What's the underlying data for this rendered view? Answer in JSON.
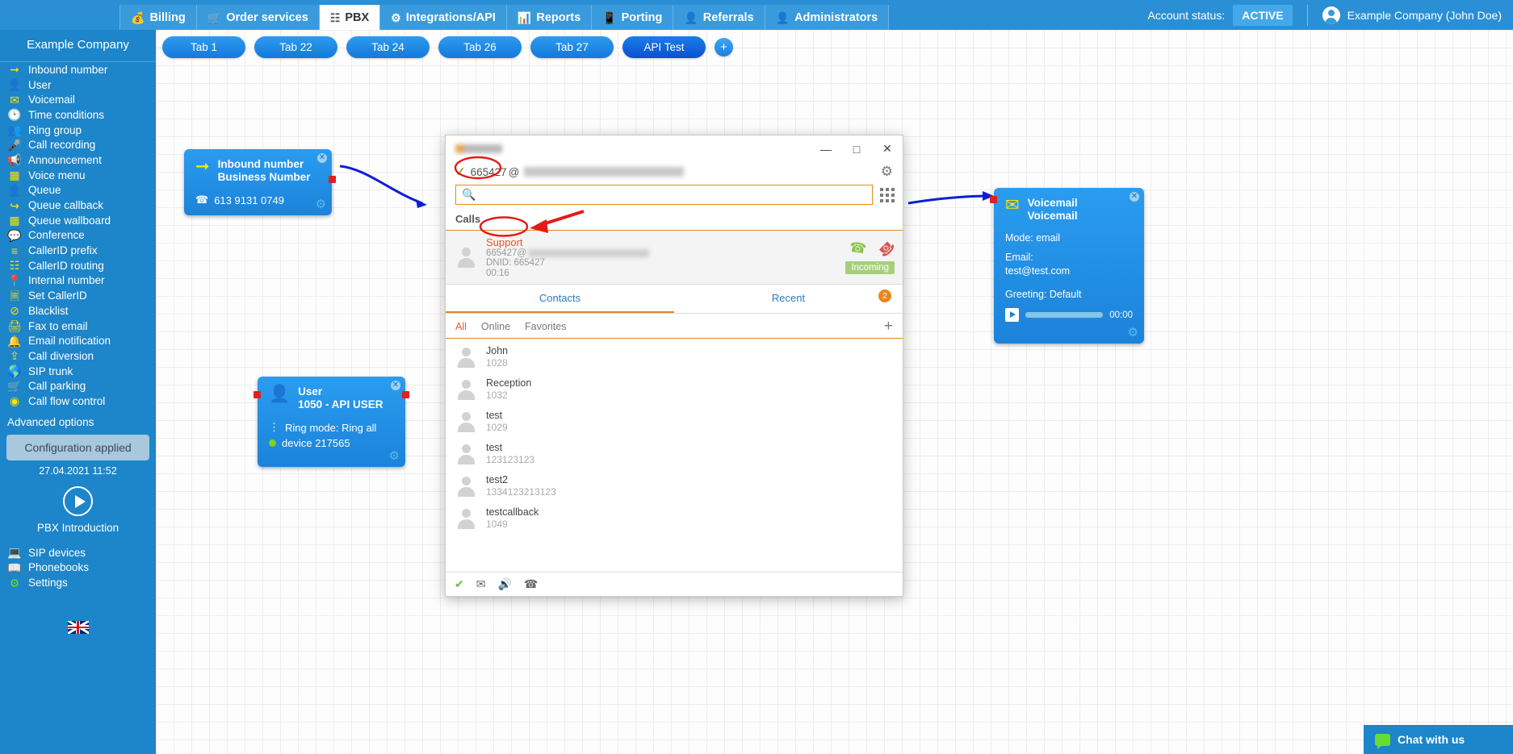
{
  "topnav": {
    "tabs": [
      {
        "label": "Billing",
        "icon": "coin-icon",
        "active": false
      },
      {
        "label": "Order services",
        "icon": "cart-icon",
        "active": false
      },
      {
        "label": "PBX",
        "icon": "pbx-icon",
        "active": true
      },
      {
        "label": "Integrations/API",
        "icon": "gear-icon",
        "active": false
      },
      {
        "label": "Reports",
        "icon": "report-icon",
        "active": false
      },
      {
        "label": "Porting",
        "icon": "phone-icon",
        "active": false
      },
      {
        "label": "Referrals",
        "icon": "person-icon",
        "active": false
      },
      {
        "label": "Administrators",
        "icon": "admin-icon",
        "active": false
      }
    ],
    "account_status_label": "Account status:",
    "account_status_value": "ACTIVE",
    "user_name": "Example Company (John Doe)"
  },
  "sidebar": {
    "title": "Example Company",
    "items": [
      {
        "label": "Inbound number",
        "icon": "arrow-right-icon"
      },
      {
        "label": "User",
        "icon": "user-icon"
      },
      {
        "label": "Voicemail",
        "icon": "envelope-icon"
      },
      {
        "label": "Time conditions",
        "icon": "clock-icon"
      },
      {
        "label": "Ring group",
        "icon": "group-icon"
      },
      {
        "label": "Call recording",
        "icon": "microphone-icon"
      },
      {
        "label": "Announcement",
        "icon": "megaphone-icon"
      },
      {
        "label": "Voice menu",
        "icon": "grid-icon"
      },
      {
        "label": "Queue",
        "icon": "user-plus-icon"
      },
      {
        "label": "Queue callback",
        "icon": "arrow-back-icon"
      },
      {
        "label": "Queue wallboard",
        "icon": "table-icon"
      },
      {
        "label": "Conference",
        "icon": "chat-icon"
      },
      {
        "label": "CallerID prefix",
        "icon": "list-icon"
      },
      {
        "label": "CallerID routing",
        "icon": "sitemap-icon"
      },
      {
        "label": "Internal number",
        "icon": "pin-icon"
      },
      {
        "label": "Set CallerID",
        "icon": "id-card-icon"
      },
      {
        "label": "Blacklist",
        "icon": "ban-icon"
      },
      {
        "label": "Fax to email",
        "icon": "fax-icon"
      },
      {
        "label": "Email notification",
        "icon": "bell-icon"
      },
      {
        "label": "Call diversion",
        "icon": "upload-icon"
      },
      {
        "label": "SIP trunk",
        "icon": "globe-icon"
      },
      {
        "label": "Call parking",
        "icon": "cart-icon"
      },
      {
        "label": "Call flow control",
        "icon": "toggle-icon"
      }
    ],
    "advanced_options": "Advanced options",
    "config_applied": "Configuration applied",
    "config_time": "27.04.2021 11:52",
    "pbx_intro": "PBX Introduction",
    "bottom_items": [
      {
        "label": "SIP devices",
        "icon": "monitor-icon"
      },
      {
        "label": "Phonebooks",
        "icon": "book-icon"
      },
      {
        "label": "Settings",
        "icon": "gear-icon"
      }
    ],
    "language_flag": "uk-flag"
  },
  "flow_tabs": [
    {
      "label": "Tab 1",
      "active": false
    },
    {
      "label": "Tab 22",
      "active": false
    },
    {
      "label": "Tab 24",
      "active": false
    },
    {
      "label": "Tab 26",
      "active": false
    },
    {
      "label": "Tab 27",
      "active": false
    },
    {
      "label": "API Test",
      "active": true
    }
  ],
  "add_tab_label": "+",
  "nodes": {
    "inbound": {
      "type": "Inbound number",
      "name": "Business Number",
      "phone": "613 9131 0749",
      "icon": "arrow-right-icon"
    },
    "user": {
      "type": "User",
      "name": "1050 - API USER",
      "ring_mode": "Ring mode: Ring all",
      "device": "device 217565",
      "icon": "user-icon"
    },
    "voicemail": {
      "type": "Voicemail",
      "name": "Voicemail",
      "mode": "Mode: email",
      "email_label": "Email:",
      "email": "test@test.com",
      "greeting": "Greeting: Default",
      "duration": "00:00",
      "icon": "envelope-icon"
    }
  },
  "softphone": {
    "window_controls": {
      "minimize": "—",
      "maximize": "□",
      "close": "✕"
    },
    "account_extension": "665427",
    "account_at": "@",
    "search_placeholder": "",
    "search_value": "",
    "calls_header": "Calls",
    "call": {
      "name": "Support",
      "sip_prefix": "665427@",
      "dnid": "DNID: 665427",
      "duration": "00:16",
      "status": "Incoming",
      "accept_icon": "phone-accept-icon",
      "reject_icon": "phone-hangup-icon"
    },
    "tabs": [
      {
        "label": "Contacts",
        "active": true
      },
      {
        "label": "Recent",
        "active": false,
        "badge": "2"
      }
    ],
    "filters": [
      {
        "label": "All",
        "active": true
      },
      {
        "label": "Online",
        "active": false
      },
      {
        "label": "Favorites",
        "active": false
      }
    ],
    "add_contact": "+",
    "contacts": [
      {
        "name": "John",
        "number": "1028"
      },
      {
        "name": "Reception",
        "number": "1032"
      },
      {
        "name": "test",
        "number": "1029"
      },
      {
        "name": "test",
        "number": "123123123"
      },
      {
        "name": "test2",
        "number": "1334123213123"
      },
      {
        "name": "testcallback",
        "number": "1049"
      }
    ],
    "footer_icons": [
      "status-available-icon",
      "voicemail-icon",
      "volume-icon",
      "mute-call-icon"
    ]
  },
  "chat": {
    "label": "Chat with us",
    "icon": "chat-bubble-icon"
  },
  "colors": {
    "brand_blue": "#1d85c9",
    "nav_blue": "#2a8fd4",
    "accent_orange": "#e08a1e",
    "node_blue": "#1b83d9",
    "icon_yellow": "#ffe400",
    "annotation_red": "#e41b17",
    "status_green": "#a6cf7a"
  }
}
